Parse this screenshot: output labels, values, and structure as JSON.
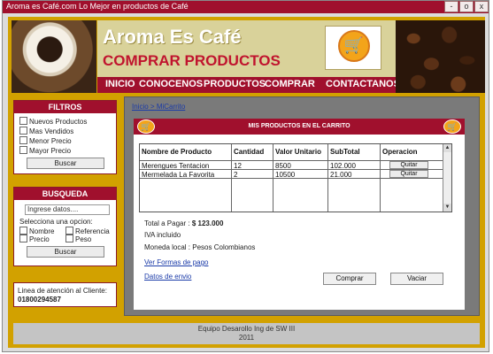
{
  "window": {
    "title": "Aroma es Café.com Lo Mejor en productos de Café",
    "minimize": "-",
    "maximize": "o",
    "close": "x"
  },
  "header": {
    "brand": "Aroma Es Café",
    "subtitle": "COMPRAR PRODUCTOS",
    "nav": [
      "INICIO",
      "CONOCENOS",
      "PRODUCTOS",
      "COMPRAR",
      "CONTACTANOS"
    ]
  },
  "filtros": {
    "title": "FILTROS",
    "options": [
      "Nuevos Productos",
      "Mas Vendidos",
      "Menor Precio",
      "Mayor Precio"
    ],
    "button": "Buscar"
  },
  "busqueda": {
    "title": "BUSQUEDA",
    "placeholder": "Ingrese datos....",
    "instruction": "Selecciona una opcion:",
    "options": [
      "Nombre",
      "Referencia",
      "Precio",
      "Peso"
    ],
    "button": "Buscar"
  },
  "contact": {
    "label": "Linea de atención al Cliente:",
    "phone": "01800294587"
  },
  "breadcrumb": {
    "home": "Inicio",
    "separator": ">",
    "current": "MiCarrito"
  },
  "cart": {
    "title": "MIS PRODUCTOS EN EL  CARRITO",
    "columns": [
      "Nombre de Producto",
      "Cantidad",
      "Valor Unitario",
      "SubTotal",
      "Operacion"
    ],
    "rows": [
      {
        "name": "Merengues Tentacion",
        "qty": "12",
        "unit": "8500",
        "subtotal": "102.000",
        "action": "Quitar"
      },
      {
        "name": "Mermelada La Favorita",
        "qty": "2",
        "unit": "10500",
        "subtotal": "21.000",
        "action": "Quitar"
      }
    ],
    "total_label": "Total a Pagar :",
    "total_value": "$ 123.000",
    "iva": "IVA incluido",
    "currency": "Moneda local : Pesos Colombianos",
    "payment_link": "Ver Formas de pago",
    "shipping_link": "Datos de envio",
    "buy_button": "Comprar",
    "empty_button": "Vaciar"
  },
  "footer": {
    "line1": "Equipo Desarollo Ing de SW III",
    "line2": "2011"
  },
  "colors": {
    "brand_red": "#a0102d",
    "gold": "#d2a100",
    "link": "#1a3aa8"
  }
}
